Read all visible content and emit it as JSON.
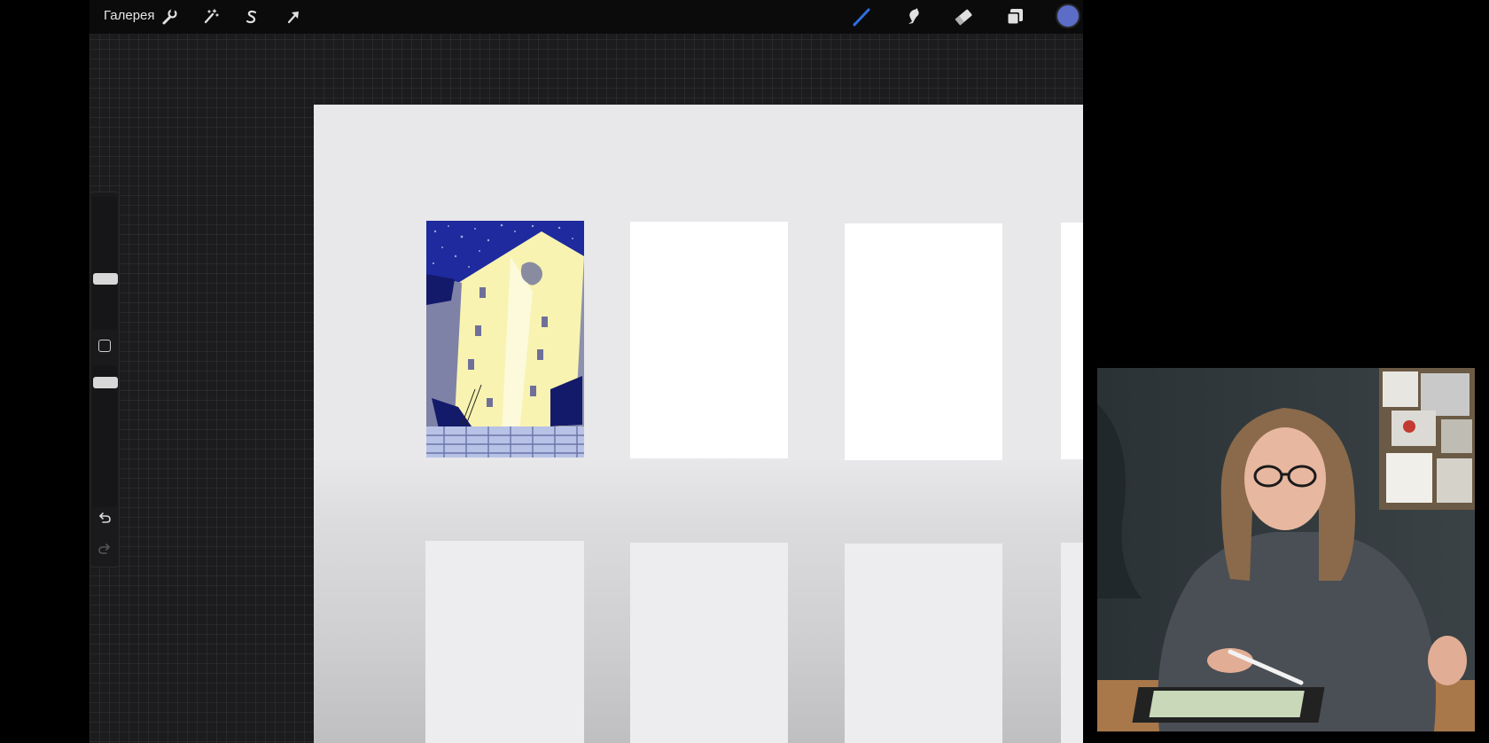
{
  "toolbar": {
    "gallery_label": "Галерея",
    "left_tools": [
      "wrench-icon",
      "magic-wand-icon",
      "selection-s-icon",
      "transform-arrow-icon"
    ],
    "right_tools": [
      "brush-icon",
      "smudge-icon",
      "eraser-icon",
      "layers-icon"
    ],
    "brush_active_color": "#2f6fe0",
    "current_color": "#5b6dc7"
  },
  "sidebar": {
    "brush_size_slider": "brush-size",
    "opacity_slider": "brush-opacity",
    "undo_icon": "undo-icon",
    "redo_icon": "redo-icon"
  },
  "canvas": {
    "background": "#e8e7ea",
    "artwork_colors": {
      "sky": "#1e2a9e",
      "building": "#f8f3b0",
      "shadow": "#8a90b0",
      "dark": "#141a6a"
    }
  }
}
